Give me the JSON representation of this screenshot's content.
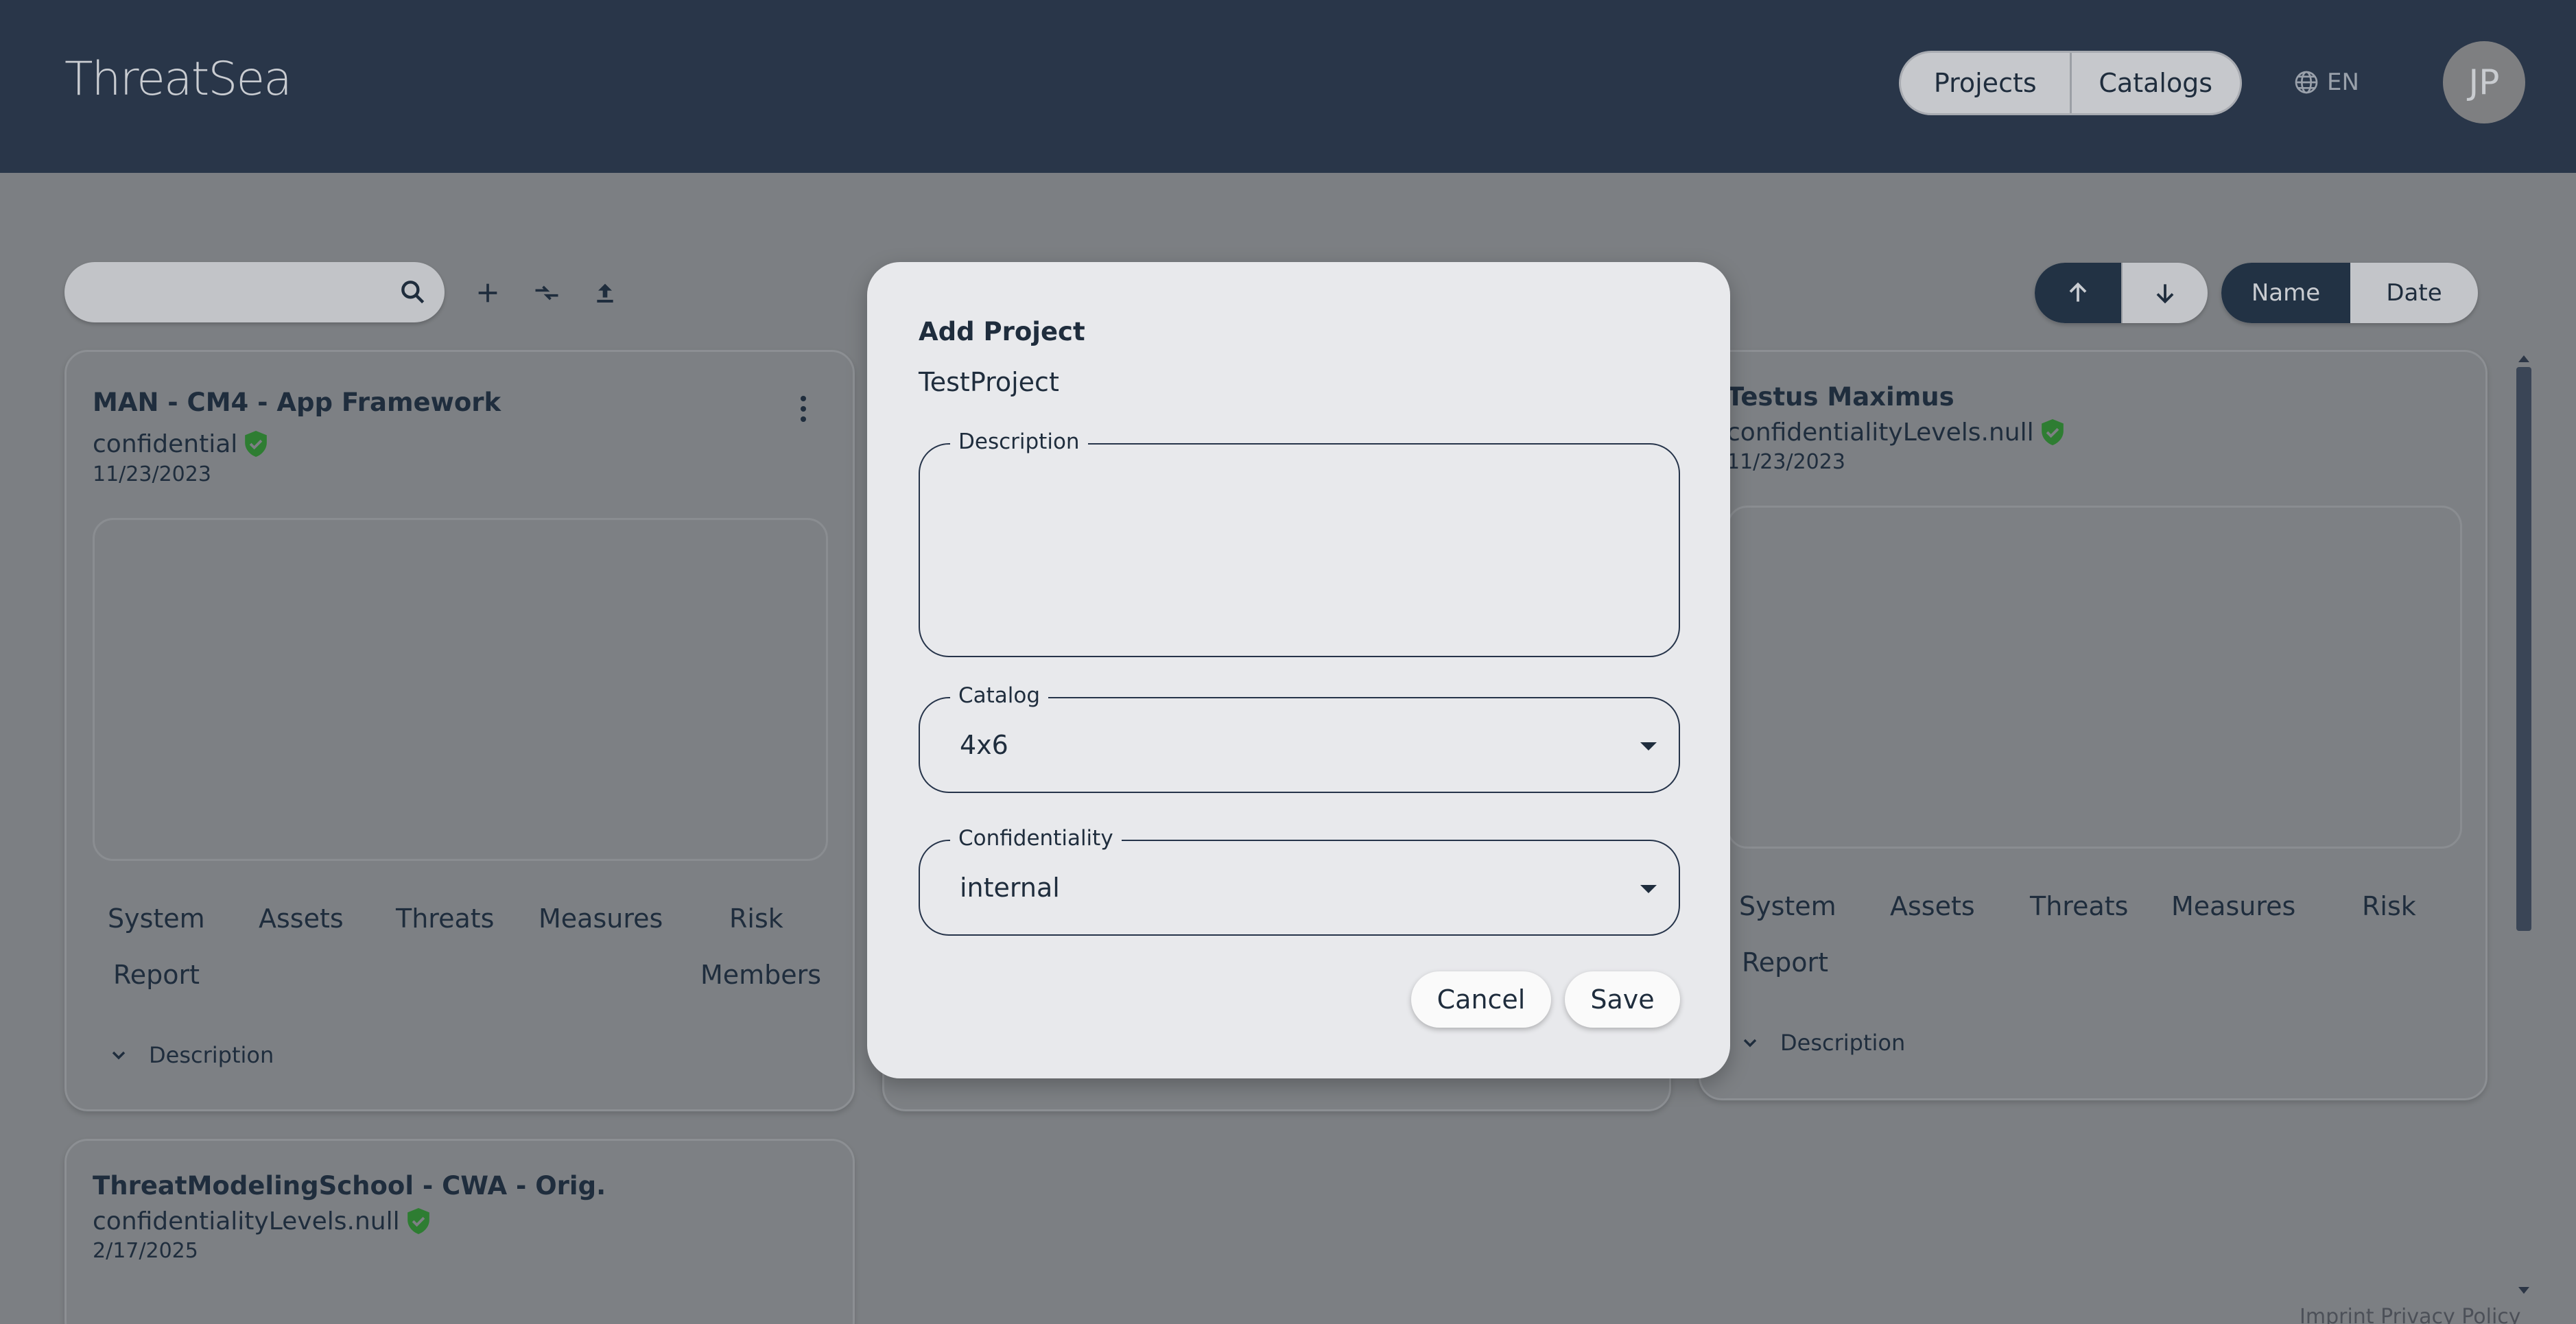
{
  "header": {
    "logo": "ThreatSea",
    "nav": [
      "Projects",
      "Catalogs"
    ],
    "language": "EN",
    "avatar_initials": "JP"
  },
  "toolbar": {
    "search_placeholder": "",
    "sort_name": "Name",
    "sort_date": "Date"
  },
  "cards": [
    {
      "title": "MAN - CM4 - App Framework",
      "confidentiality": "confidential",
      "date": "11/23/2023",
      "links": [
        "System",
        "Assets",
        "Threats",
        "Measures",
        "Risk",
        "Report",
        "Members"
      ],
      "description_toggle": "Description"
    },
    {
      "title": "Testus Maximus",
      "confidentiality": "confidentialityLevels.null",
      "date": "11/23/2023",
      "links": [
        "System",
        "Assets",
        "Threats",
        "Measures",
        "Risk",
        "Report"
      ],
      "description_toggle": "Description"
    },
    {
      "title": "ThreatModelingSchool - CWA - Orig.",
      "confidentiality": "confidentialityLevels.null",
      "date": "2/17/2025"
    }
  ],
  "modal": {
    "title": "Add Project",
    "project_name": "TestProject",
    "description_label": "Description",
    "description_value": "",
    "catalog_label": "Catalog",
    "catalog_value": "4x6",
    "confidentiality_label": "Confidentiality",
    "confidentiality_value": "internal",
    "cancel": "Cancel",
    "save": "Save"
  },
  "footer": {
    "links": "Imprint   Privacy Policy"
  },
  "colors": {
    "header_bg": "#293649",
    "accent": "#223244",
    "shield": "#2e7d32",
    "overlay": "#7c7f83"
  }
}
